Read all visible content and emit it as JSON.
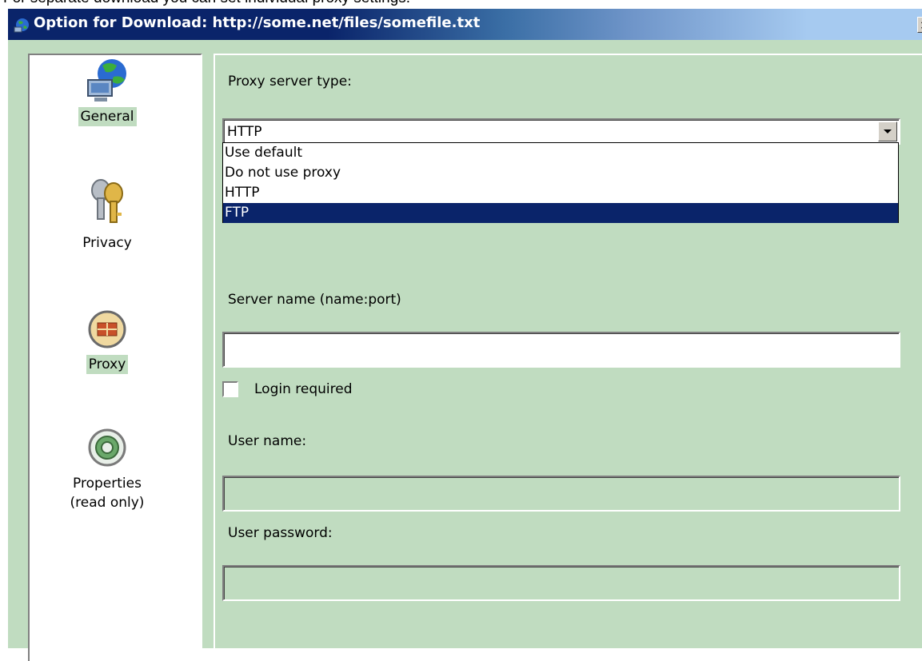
{
  "caption": "For separate download you can set individual proxy settings:",
  "window": {
    "title": "Option for Download: http://some.net/files/somefile.txt"
  },
  "sidebar": {
    "items": [
      {
        "label": "General",
        "icon": "globe-computer-icon",
        "selected": true
      },
      {
        "label": "Privacy",
        "icon": "keys-icon",
        "selected": false
      },
      {
        "label": "Proxy",
        "icon": "proxy-icon",
        "selected": true
      },
      {
        "label": "Properties\n(read only)",
        "icon": "properties-icon",
        "selected": false
      }
    ]
  },
  "proxy": {
    "type_label": "Proxy server type:",
    "type_value": "HTTP",
    "options": [
      "Use default",
      "Do not use proxy",
      "HTTP",
      "FTP"
    ],
    "highlighted_option": "FTP",
    "server_label": "Server name (name:port)",
    "server_value": "",
    "login_label": "Login required",
    "login_checked": false,
    "user_label": "User name:",
    "user_value": "",
    "password_label": "User password:",
    "password_value": ""
  },
  "colors": {
    "dialog_bg": "#c0dcc0",
    "title_start": "#0a246a",
    "title_end": "#a6caf0",
    "selection": "#0a246a"
  }
}
